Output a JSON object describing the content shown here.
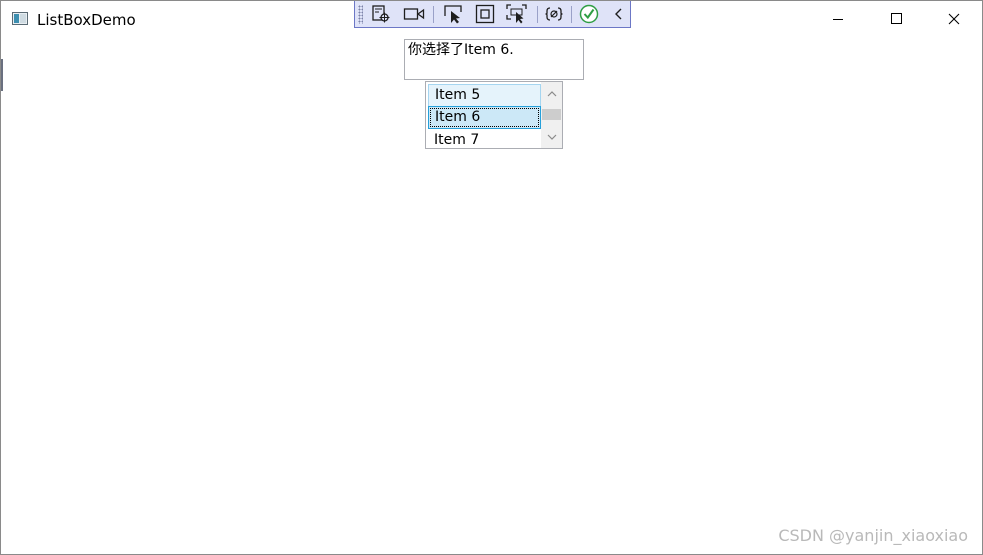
{
  "window": {
    "title": "ListBoxDemo"
  },
  "debug_toolbar": {
    "icons": [
      "live-visual-tree-icon",
      "record-icon",
      "select-element-icon",
      "display-adorners-icon",
      "track-focus-icon",
      "binding-failures-icon",
      "hot-reload-ok-icon",
      "collapse-icon"
    ]
  },
  "result_box": {
    "text": "你选择了Item 6."
  },
  "listbox": {
    "items": [
      {
        "label": "Item 5",
        "state": "hover"
      },
      {
        "label": "Item 6",
        "state": "selected"
      },
      {
        "label": "Item 7",
        "state": "normal"
      }
    ],
    "selected": "Item 6"
  },
  "watermark": {
    "text": "CSDN @yanjin_xiaoxiao"
  },
  "colors": {
    "toolbar_bg": "#dfe3f8",
    "toolbar_border": "#6c77c6",
    "selection_bg": "#cce8f7",
    "selection_border": "#26a0da",
    "hover_bg": "#e5f3fb"
  }
}
